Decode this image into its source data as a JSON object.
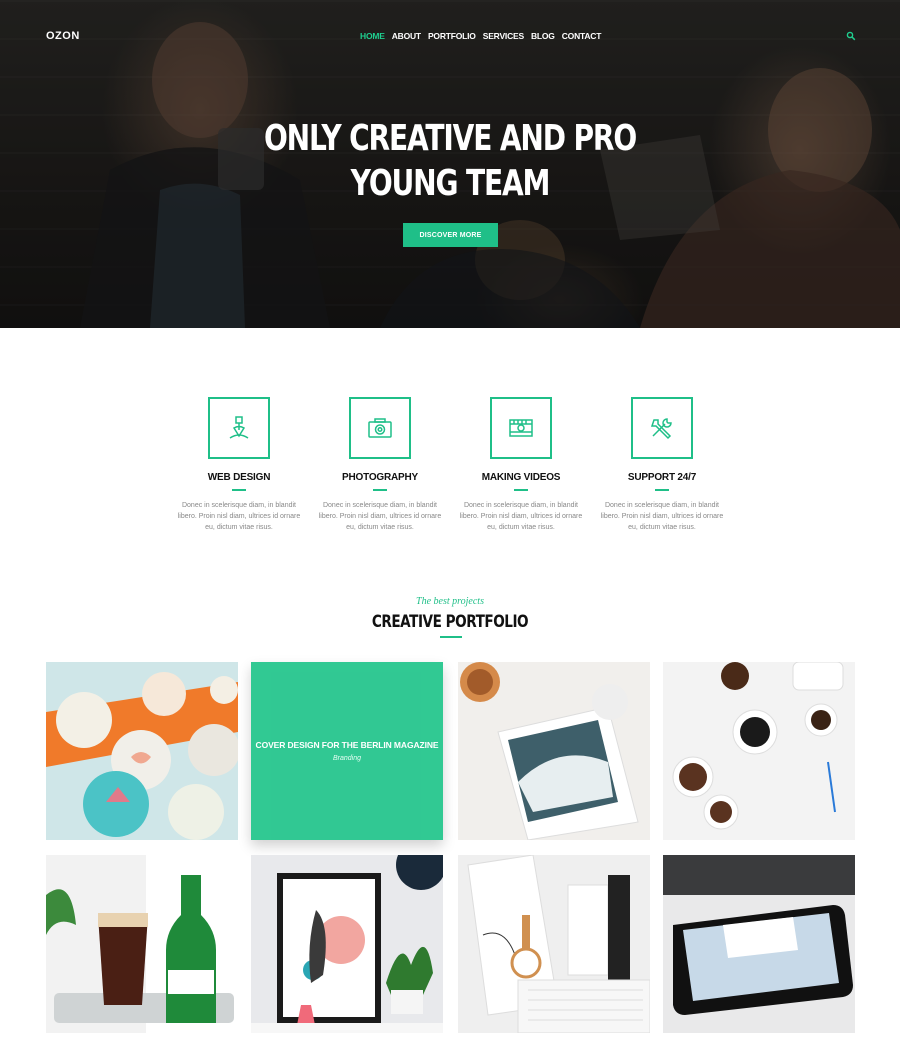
{
  "brand": {
    "logo": "OZON",
    "accent": "#1fbf88"
  },
  "nav": {
    "items": [
      "HOME",
      "ABOUT",
      "PORTFOLIO",
      "SERVICES",
      "BLOG",
      "CONTACT"
    ],
    "active": "HOME",
    "search_icon": "search-icon"
  },
  "hero": {
    "title_line1": "ONLY CREATIVE AND PRO",
    "title_line2": "YOUNG TEAM",
    "button": "DISCOVER MORE"
  },
  "services": [
    {
      "icon": "pen-nib-icon",
      "title": "WEB DESIGN",
      "desc_l1": "Donec in scelerisque diam, in blandit",
      "desc_l2": "libero. Proin nisl diam, ultrices id ornare",
      "desc_l3": "eu, dictum vitae risus."
    },
    {
      "icon": "camera-icon",
      "title": "PHOTOGRAPHY",
      "desc_l1": "Donec in scelerisque diam, in blandit",
      "desc_l2": "libero. Proin nisl diam, ultrices id ornare",
      "desc_l3": "eu, dictum vitae risus."
    },
    {
      "icon": "film-icon",
      "title": "MAKING VIDEOS",
      "desc_l1": "Donec in scelerisque diam, in blandit",
      "desc_l2": "libero. Proin nisl diam, ultrices id ornare",
      "desc_l3": "eu, dictum vitae risus."
    },
    {
      "icon": "tools-icon",
      "title": "SUPPORT 24/7",
      "desc_l1": "Donec in scelerisque diam, in blandit",
      "desc_l2": "libero. Proin nisl diam, ultrices id ornare",
      "desc_l3": "eu, dictum vitae risus."
    }
  ],
  "portfolio": {
    "kicker": "The best projects",
    "title": "CREATIVE PORTFOLIO",
    "featured": {
      "title": "COVER DESIGN FOR THE BERLIN MAGAZINE",
      "category": "Branding"
    }
  }
}
